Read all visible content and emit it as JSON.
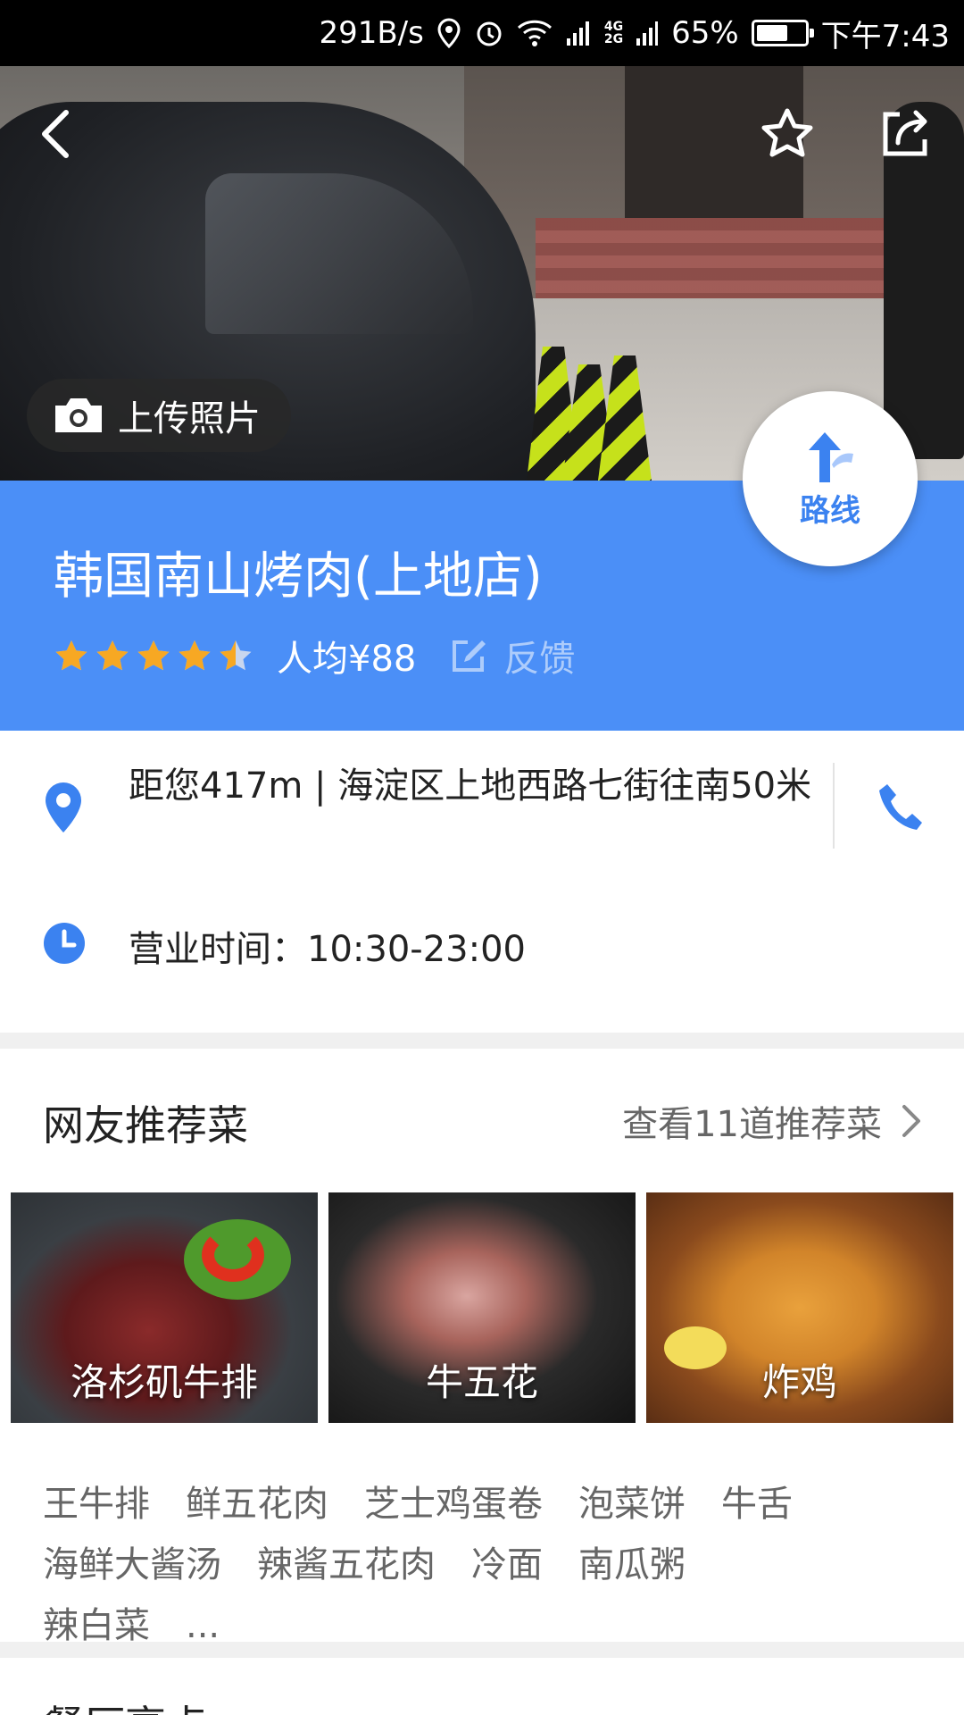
{
  "status_bar": {
    "net_speed": "291B/s",
    "net_type_top": "4G",
    "net_type_bottom": "2G",
    "battery": "65%",
    "battery_level": 0.65,
    "time": "下午7:43"
  },
  "hero": {
    "upload_label": "上传照片"
  },
  "shop": {
    "name": "韩国南山烤肉(上地店)",
    "rating_stars": 4.5,
    "avg_price": "人均¥88",
    "feedback_label": "反馈",
    "route_label": "路线"
  },
  "info": {
    "address": "距您417m | 海淀区上地西路七街往南50米",
    "hours": "营业时间：10:30-23:00"
  },
  "recommend": {
    "title": "网友推荐菜",
    "more_label": "查看11道推荐菜",
    "dishes": [
      {
        "name": "洛杉矶牛排"
      },
      {
        "name": "牛五花"
      },
      {
        "name": "炸鸡"
      }
    ],
    "tags": [
      "王牛排",
      "鲜五花肉",
      "芝士鸡蛋卷",
      "泡菜饼",
      "牛舌",
      "海鲜大酱汤",
      "辣酱五花肉",
      "冷面",
      "南瓜粥",
      "辣白菜",
      "..."
    ]
  },
  "next_section": {
    "title": "餐厅亮点"
  },
  "colors": {
    "brand_blue": "#4b8ff7",
    "star": "#f7a823",
    "icon_blue": "#3b82f0"
  }
}
